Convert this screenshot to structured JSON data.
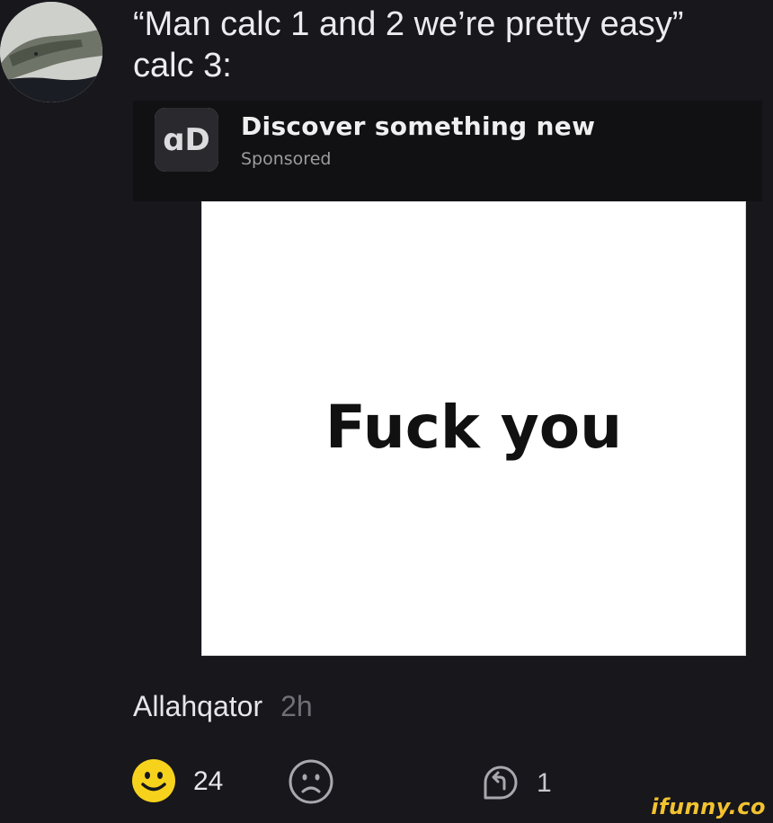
{
  "post": {
    "caption_line1": "“Man calc 1 and 2 we’re pretty easy”",
    "caption_line2": "calc 3:"
  },
  "ad": {
    "logo_text": "ɑD",
    "title": "Discover something new",
    "subtitle": "Sponsored",
    "image_text": "Fuck you"
  },
  "comment": {
    "author": "Allahqator",
    "time": "2h"
  },
  "actions": {
    "smile_icon": "smile-icon",
    "smile_count": "24",
    "frown_icon": "frown-icon",
    "reply_icon": "reply-icon",
    "reply_count": "1"
  },
  "watermark": "ifunny.co",
  "colors": {
    "background": "#17171c",
    "smile_yellow": "#f7d21d",
    "muted": "#6f6f76",
    "watermark": "#f2c230"
  }
}
